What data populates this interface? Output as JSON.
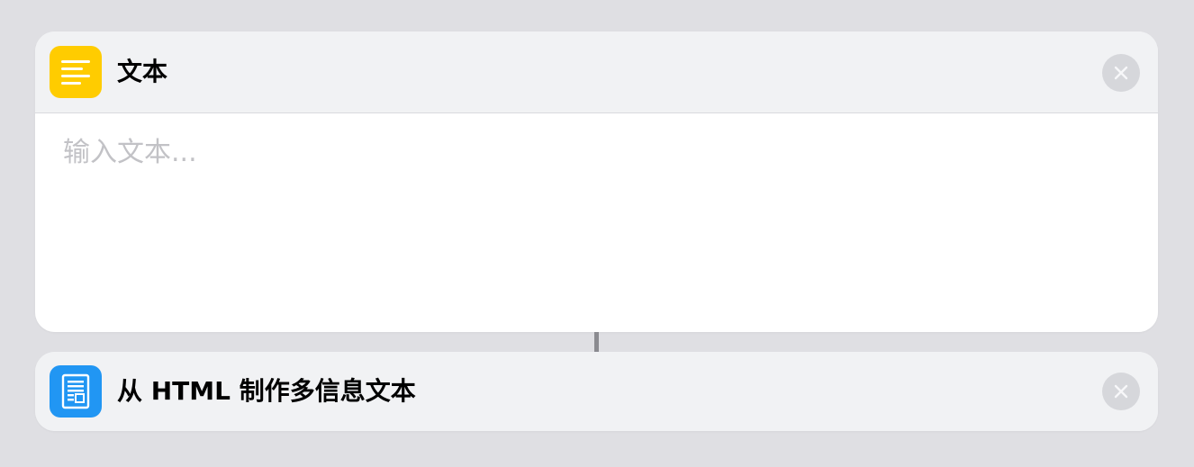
{
  "actions": [
    {
      "title": "文本",
      "icon": "text-lines-icon",
      "icon_color": "#ffcc00",
      "input_placeholder": "输入文本...",
      "input_value": ""
    },
    {
      "title": "从 HTML 制作多信息文本",
      "icon": "document-icon",
      "icon_color": "#2196f3"
    }
  ],
  "colors": {
    "background": "#dfdfe3",
    "card": "#f1f2f4",
    "close_button": "#d6d7db",
    "placeholder": "#c2c2c6"
  }
}
